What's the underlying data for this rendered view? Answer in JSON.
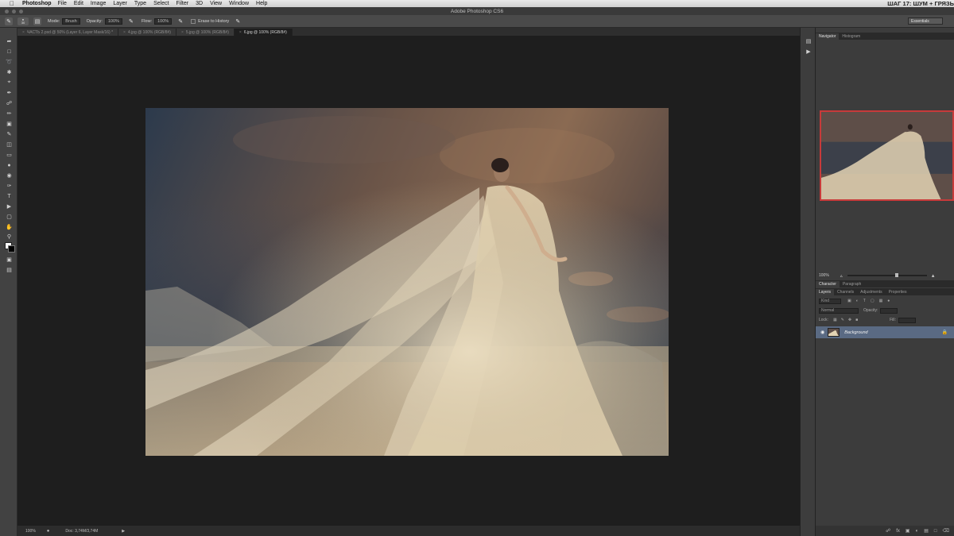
{
  "menubar": {
    "app_name": "Photoshop",
    "items": [
      "File",
      "Edit",
      "Image",
      "Layer",
      "Type",
      "Select",
      "Filter",
      "3D",
      "View",
      "Window",
      "Help"
    ],
    "overlay_text": "ШАГ 17: ШУМ + ГРЯЗЬ"
  },
  "window": {
    "title": "Adobe Photoshop CS6"
  },
  "options": {
    "brush_size": "30",
    "mode_label": "Mode:",
    "mode_value": "Brush",
    "opacity_label": "Opacity:",
    "opacity_value": "100%",
    "flow_label": "Flow:",
    "flow_value": "100%",
    "erase_history_label": "Erase to History",
    "workspace": "Essentials"
  },
  "tabs": [
    {
      "label": "ЧАСТЬ 2.psd @ 50% (Layer 6, Layer Mask/16) *",
      "active": false
    },
    {
      "label": "4.jpg @ 100% (RGB/8#)",
      "active": false
    },
    {
      "label": "5.jpg @ 100% (RGB/8#)",
      "active": false
    },
    {
      "label": "6.jpg @ 100% (RGB/8#)",
      "active": true
    }
  ],
  "status": {
    "zoom": "100%",
    "doc": "Doc: 3,74M/3,74M"
  },
  "navigator": {
    "tabs": [
      "Navigator",
      "Histogram"
    ],
    "zoom": "100%"
  },
  "char_panel": {
    "tabs": [
      "Character",
      "Paragraph"
    ]
  },
  "layers_panel": {
    "tabs": [
      "Layers",
      "Channels",
      "Adjustments",
      "Properties"
    ],
    "kind_label": "Kind",
    "blend_mode": "Normal",
    "opacity_label": "Opacity:",
    "lock_label": "Lock:",
    "fill_label": "Fill:",
    "layer_name": "Background"
  },
  "colors": {
    "foreground": "#ffffff",
    "background": "#000000",
    "selection": "#5a6a83",
    "nav_frame": "#c83a3a"
  }
}
